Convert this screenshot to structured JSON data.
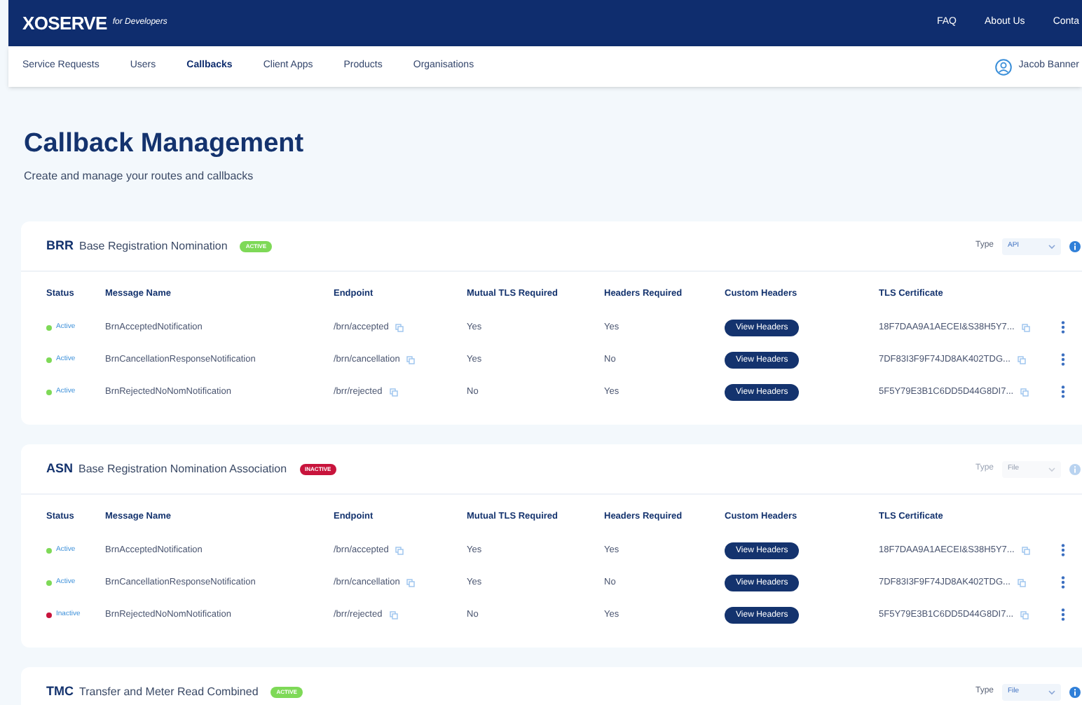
{
  "header": {
    "logo": "XOSERVE",
    "logo_sub": "for Developers",
    "links": [
      "FAQ",
      "About Us",
      "Conta"
    ]
  },
  "nav": {
    "items": [
      {
        "label": "Service Requests",
        "selected": false
      },
      {
        "label": "Users",
        "selected": false
      },
      {
        "label": "Callbacks",
        "selected": true
      },
      {
        "label": "Client Apps",
        "selected": false
      },
      {
        "label": "Products",
        "selected": false
      },
      {
        "label": "Organisations",
        "selected": false
      }
    ],
    "user": "Jacob Banner"
  },
  "page": {
    "title": "Callback Management",
    "subtitle": "Create and manage your routes and callbacks"
  },
  "sections": [
    {
      "code": "BRR",
      "name": "Base Registration Nomination",
      "badge": "ACTIVE",
      "active": true,
      "type_label": "Type",
      "type_value": "API",
      "type_disabled": false,
      "columns": [
        "Status",
        "Message Name",
        "Endpoint",
        "Mutual TLS Required",
        "Headers Required",
        "Custom Headers",
        "TLS Certificate"
      ],
      "rows": [
        {
          "status": "Active",
          "active": true,
          "message": "BrnAcceptedNotification",
          "endpoint": "/brn/accepted",
          "mutual_tls": "Yes",
          "headers_required": "Yes",
          "button": "View Headers",
          "certificate": "18F7DAA9A1AECEI&S38H5Y7..."
        },
        {
          "status": "Active",
          "active": true,
          "message": "BrnCancellationResponseNotification",
          "endpoint": "/brn/cancellation",
          "mutual_tls": "Yes",
          "headers_required": "No",
          "button": "View Headers",
          "certificate": "7DF83I3F9F74JD8AK402TDG..."
        },
        {
          "status": "Active",
          "active": true,
          "message": "BrnRejectedNoNomNotification",
          "endpoint": "/brr/rejected",
          "mutual_tls": "No",
          "headers_required": "Yes",
          "button": "View Headers",
          "certificate": "5F5Y79E3B1C6DD5D44G8DI7..."
        }
      ]
    },
    {
      "code": "ASN",
      "name": "Base Registration Nomination Association",
      "badge": "INACTIVE",
      "active": false,
      "type_label": "Type",
      "type_value": "File",
      "type_disabled": true,
      "columns": [
        "Status",
        "Message Name",
        "Endpoint",
        "Mutual TLS Required",
        "Headers Required",
        "Custom Headers",
        "TLS Certificate"
      ],
      "rows": [
        {
          "status": "Active",
          "active": true,
          "message": "BrnAcceptedNotification",
          "endpoint": "/brn/accepted",
          "mutual_tls": "Yes",
          "headers_required": "Yes",
          "button": "View Headers",
          "certificate": "18F7DAA9A1AECEI&S38H5Y7..."
        },
        {
          "status": "Active",
          "active": true,
          "message": "BrnCancellationResponseNotification",
          "endpoint": "/brn/cancellation",
          "mutual_tls": "Yes",
          "headers_required": "No",
          "button": "View Headers",
          "certificate": "7DF83I3F9F74JD8AK402TDG..."
        },
        {
          "status": "Inactive",
          "active": false,
          "message": "BrnRejectedNoNomNotification",
          "endpoint": "/brr/rejected",
          "mutual_tls": "No",
          "headers_required": "Yes",
          "button": "View Headers",
          "certificate": "5F5Y79E3B1C6DD5D44G8DI7..."
        }
      ]
    },
    {
      "code": "TMC",
      "name": "Transfer and Meter Read Combined",
      "badge": "ACTIVE",
      "active": true,
      "type_label": "Type",
      "type_value": "File",
      "type_disabled": false
    }
  ]
}
